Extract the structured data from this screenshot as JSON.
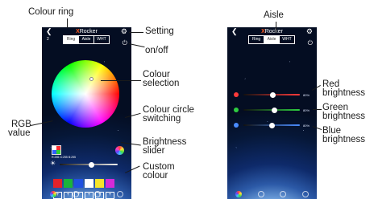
{
  "app": {
    "title_x": "X",
    "title_rest": "Rocker",
    "device_number": "2"
  },
  "tabs": [
    "Ring",
    "Aisle",
    "WHT"
  ],
  "left_screen": {
    "active_tab": "Ring",
    "rgb_text": "R:255 G:255 B:255",
    "brightness_level": 0.55,
    "custom_slots": [
      "+",
      "+",
      "+",
      "+",
      "+",
      "+"
    ],
    "swatches": [
      "#e3222a",
      "#19b43a",
      "#1f50e0",
      "#ffffff",
      "#f5e42a",
      "#d42ad8"
    ]
  },
  "right_screen": {
    "active_tab": "Aisle",
    "channels": [
      {
        "name": "red",
        "color": "#ff3a3a",
        "level": 0.52,
        "pct": "80%"
      },
      {
        "name": "green",
        "color": "#2ecc40",
        "level": 0.55,
        "pct": "80%"
      },
      {
        "name": "blue",
        "color": "#4a8cff",
        "level": 0.5,
        "pct": "80%"
      }
    ]
  },
  "annotations": {
    "colour_ring": "Colour ring",
    "setting": "Setting",
    "on_off": "on/off",
    "colour_selection_1": "Colour",
    "colour_selection_2": "selection",
    "rgb_1": "RGB",
    "rgb_2": "value",
    "circle_switch_1": "Colour circle",
    "circle_switch_2": "switching",
    "brightness_1": "Brightness",
    "brightness_2": "slider",
    "custom_1": "Custom",
    "custom_2": "colour",
    "aisle": "Aisle",
    "red_1": "Red",
    "red_2": "brightness",
    "green_1": "Green",
    "green_2": "brightness",
    "blue_1": "Blue",
    "blue_2": "brightness"
  }
}
